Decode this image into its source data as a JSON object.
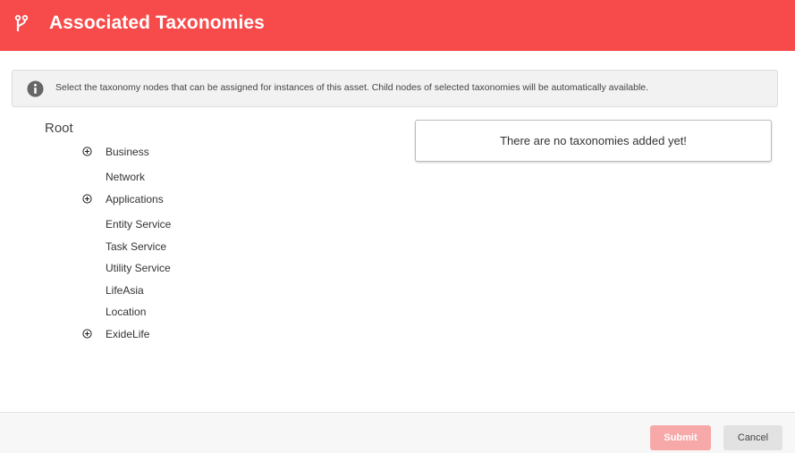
{
  "header": {
    "title": "Associated Taxonomies",
    "icon": "branch-icon",
    "background_color": "#f74b4b"
  },
  "info": {
    "icon": "info-icon",
    "text": "Select the taxonomy nodes that can be assigned for instances of this asset. Child nodes of selected taxonomies will be automatically available."
  },
  "tree": {
    "root_label": "Root",
    "items": [
      {
        "label": "Business",
        "expandable": true
      },
      {
        "label": "Network",
        "expandable": false
      },
      {
        "label": "Applications",
        "expandable": true
      },
      {
        "label": "Entity Service",
        "expandable": false
      },
      {
        "label": "Task Service",
        "expandable": false
      },
      {
        "label": "Utility Service",
        "expandable": false
      },
      {
        "label": "LifeAsia",
        "expandable": false
      },
      {
        "label": "Location",
        "expandable": false
      },
      {
        "label": "ExideLife",
        "expandable": true
      }
    ]
  },
  "selected": {
    "empty_message": "There are no taxonomies added yet!"
  },
  "footer": {
    "submit_label": "Submit",
    "cancel_label": "Cancel",
    "submit_color": "#f7a9a9"
  }
}
